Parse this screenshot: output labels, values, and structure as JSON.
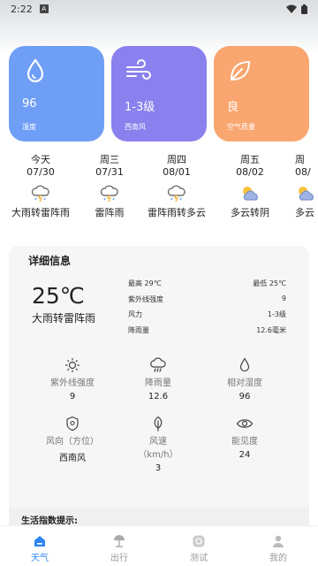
{
  "status": {
    "time": "2:22",
    "notif": "A"
  },
  "cards": [
    {
      "value": "96",
      "label": "湿度",
      "icon": "water-drop-icon",
      "color": "#6f9ef6"
    },
    {
      "value": "1-3级",
      "label": "西南风",
      "icon": "wind-icon",
      "color": "#8a80ee"
    },
    {
      "value": "良",
      "label": "空气质量",
      "icon": "leaf-icon",
      "color": "#f9a670"
    }
  ],
  "forecast": [
    {
      "name": "今天",
      "date": "07/30",
      "desc": "大雨转雷阵雨",
      "icon": "thunder-rain-icon"
    },
    {
      "name": "周三",
      "date": "07/31",
      "desc": "雷阵雨",
      "icon": "thunder-rain-icon"
    },
    {
      "name": "周四",
      "date": "08/01",
      "desc": "雷阵雨转多云",
      "icon": "thunder-rain-icon"
    },
    {
      "name": "周五",
      "date": "08/02",
      "desc": "多云转阴",
      "icon": "partly-cloudy-icon"
    },
    {
      "name": "周",
      "date": "08/",
      "desc": "多云",
      "icon": "partly-cloudy-icon"
    }
  ],
  "detail": {
    "title": "详细信息",
    "temp": "25℃",
    "weather": "大雨转雷阵雨",
    "high": "最高 29℃",
    "low": "最低 25℃",
    "rows": [
      {
        "label": "紫外线强度",
        "value": "9"
      },
      {
        "label": "风力",
        "value": "1-3级"
      },
      {
        "label": "降雨量",
        "value": "12.6毫米"
      }
    ],
    "metrics": [
      {
        "label": "紫外线强度",
        "value": "9",
        "icon": "sun-icon"
      },
      {
        "label": "降雨量",
        "value": "12.6",
        "icon": "rain-cloud-icon"
      },
      {
        "label": "相对湿度",
        "value": "96",
        "icon": "water-drop-icon"
      },
      {
        "label": "风向（方位）",
        "value": "西南风",
        "icon": "location-shield-icon"
      },
      {
        "label": "风速（km/h）",
        "value": "3",
        "icon": "leaf-icon"
      },
      {
        "label": "能见度",
        "value": "24",
        "icon": "eye-icon"
      }
    ]
  },
  "life": {
    "title": "生活指数提示:"
  },
  "tabs": [
    {
      "label": "天气",
      "icon": "home-icon",
      "active": true
    },
    {
      "label": "出行",
      "icon": "beach-umbrella-icon",
      "active": false
    },
    {
      "label": "测试",
      "icon": "test-icon",
      "active": false
    },
    {
      "label": "我的",
      "icon": "user-icon",
      "active": false
    }
  ],
  "colors": {
    "accent": "#2f86f6",
    "card_blue": "#6f9ef6",
    "card_purple": "#8a80ee",
    "card_orange": "#f9a670"
  }
}
